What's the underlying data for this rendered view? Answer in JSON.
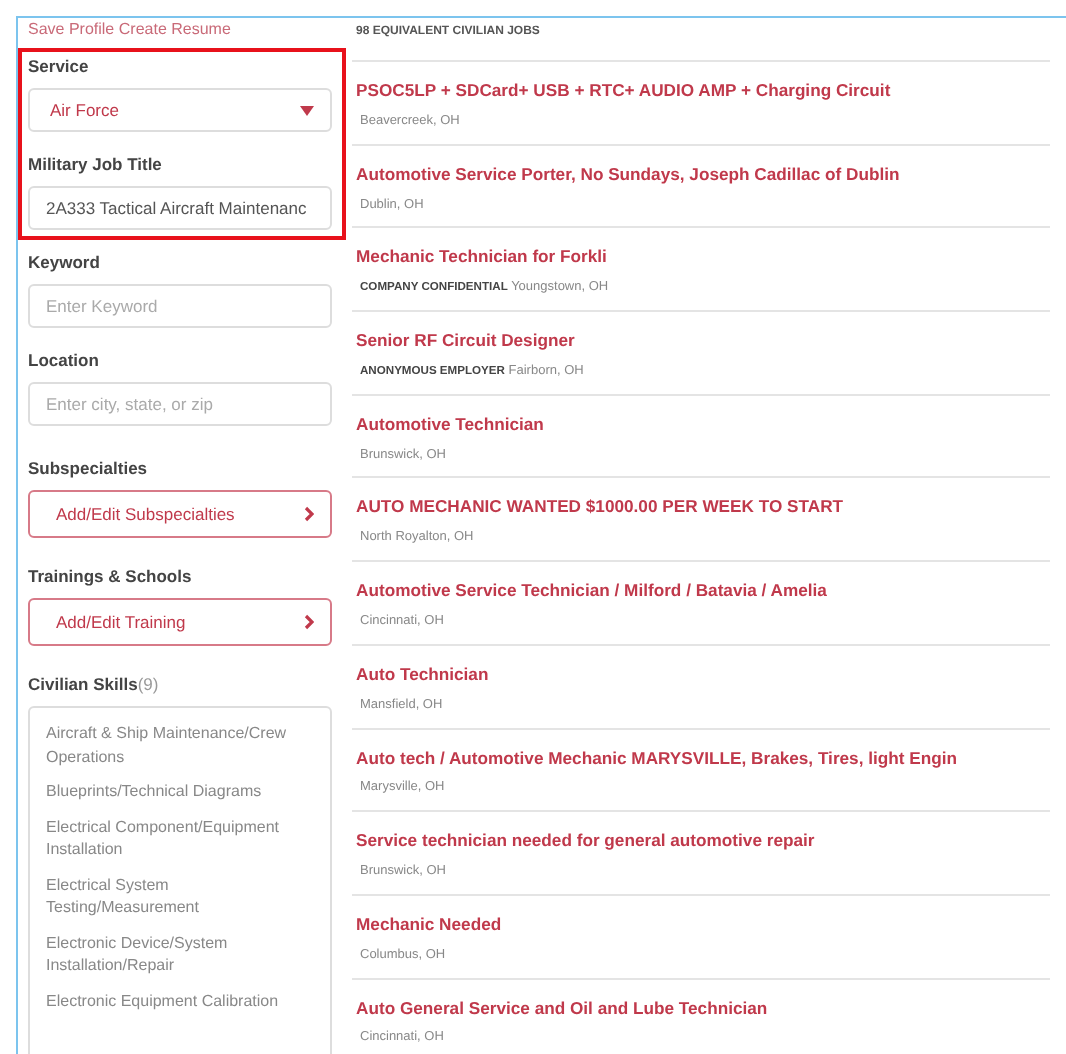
{
  "profile_links": [
    {
      "label": "Save Profile"
    },
    {
      "label": "Create Resume"
    }
  ],
  "filters": {
    "service": {
      "label": "Service",
      "value": "Air Force"
    },
    "job_title": {
      "label": "Military Job Title",
      "value": "2A333 Tactical Aircraft Maintenanc"
    },
    "keyword": {
      "label": "Keyword",
      "placeholder": "Enter Keyword"
    },
    "location": {
      "label": "Location",
      "placeholder": "Enter city, state, or zip"
    },
    "subspecialties": {
      "label": "Subspecialties",
      "button": "Add/Edit Subspecialties"
    },
    "trainings": {
      "label": "Trainings & Schools",
      "button": "Add/Edit Training"
    },
    "skills": {
      "label": "Civilian Skills",
      "count": "(9)",
      "items": [
        "Aircraft & Ship Maintenance/Crew Operations",
        "Blueprints/Technical Diagrams",
        "Electrical Component/Equipment Installation",
        "Electrical System Testing/Measurement",
        "Electronic Device/System Installation/Repair",
        "Electronic Equipment Calibration"
      ]
    }
  },
  "results": {
    "heading": "98 EQUIVALENT CIVILIAN JOBS",
    "jobs": [
      {
        "title": "PSOC5LP + SDCard+ USB + RTC+ AUDIO AMP + Charging Circuit",
        "location": "Beavercreek, OH"
      },
      {
        "title": "Automotive Service Porter, No Sundays, Joseph Cadillac of Dublin",
        "location": "Dublin, OH"
      },
      {
        "title": "Mechanic Technician for Forkli",
        "employer": "COMPANY CONFIDENTIAL",
        "location": "Youngstown, OH"
      },
      {
        "title": "Senior RF Circuit Designer",
        "employer": "ANONYMOUS EMPLOYER",
        "location": "Fairborn, OH"
      },
      {
        "title": "Automotive Technician",
        "location": "Brunswick, OH"
      },
      {
        "title": "AUTO MECHANIC WANTED $1000.00 PER WEEK TO START",
        "location": "North Royalton, OH"
      },
      {
        "title": "Automotive Service Technician / Milford / Batavia / Amelia",
        "location": "Cincinnati, OH"
      },
      {
        "title": "Auto Technician",
        "location": "Mansfield, OH"
      },
      {
        "title": "Auto tech / Automotive Mechanic MARYSVILLE, Brakes, Tires, light Engin",
        "location": "Marysville, OH"
      },
      {
        "title": "Service technician needed for general automotive repair",
        "location": "Brunswick, OH"
      },
      {
        "title": "Mechanic Needed",
        "location": "Columbus, OH"
      },
      {
        "title": "Auto General Service and Oil and Lube Technician",
        "location": "Cincinnati, OH"
      }
    ]
  }
}
